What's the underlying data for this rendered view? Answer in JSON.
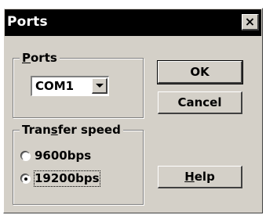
{
  "window": {
    "title": "Ports",
    "close_glyph": "×"
  },
  "ports_group": {
    "label_prefix": "",
    "label_accel": "P",
    "label_rest": "orts",
    "selected": "COM1"
  },
  "transfer_group": {
    "label_prefix": "Tran",
    "label_accel": "s",
    "label_rest": "fer speed",
    "options": [
      {
        "label": "9600bps",
        "checked": false
      },
      {
        "label": "19200bps",
        "checked": true
      }
    ]
  },
  "buttons": {
    "ok": "OK",
    "cancel": "Cancel",
    "help_accel": "H",
    "help_rest": "elp"
  }
}
